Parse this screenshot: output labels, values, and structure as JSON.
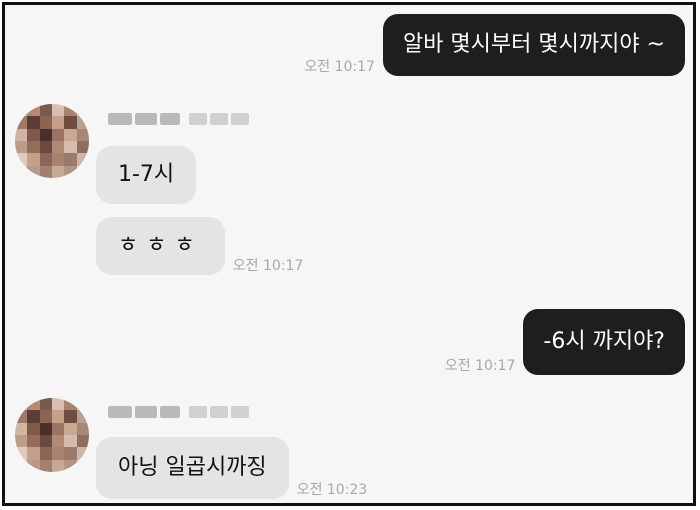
{
  "chat": {
    "messages": [
      {
        "side": "me",
        "text": "알바 몇시부터 몇시까지야 ~",
        "time": "오전 10:17"
      },
      {
        "side": "other",
        "text": "1-7시"
      },
      {
        "side": "other",
        "text": "ㅎㅎㅎ",
        "time": "오전 10:17"
      },
      {
        "side": "me",
        "text": "-6시 까지야?",
        "time": "오전 10:17"
      },
      {
        "side": "other",
        "text": "아닝 일곱시까징",
        "time": "오전 10:23"
      }
    ]
  },
  "colors": {
    "my_bubble": "#1e1e1e",
    "their_bubble": "#e4e4e4",
    "background": "#f6f6f6",
    "timestamp": "#a8a8a8"
  }
}
